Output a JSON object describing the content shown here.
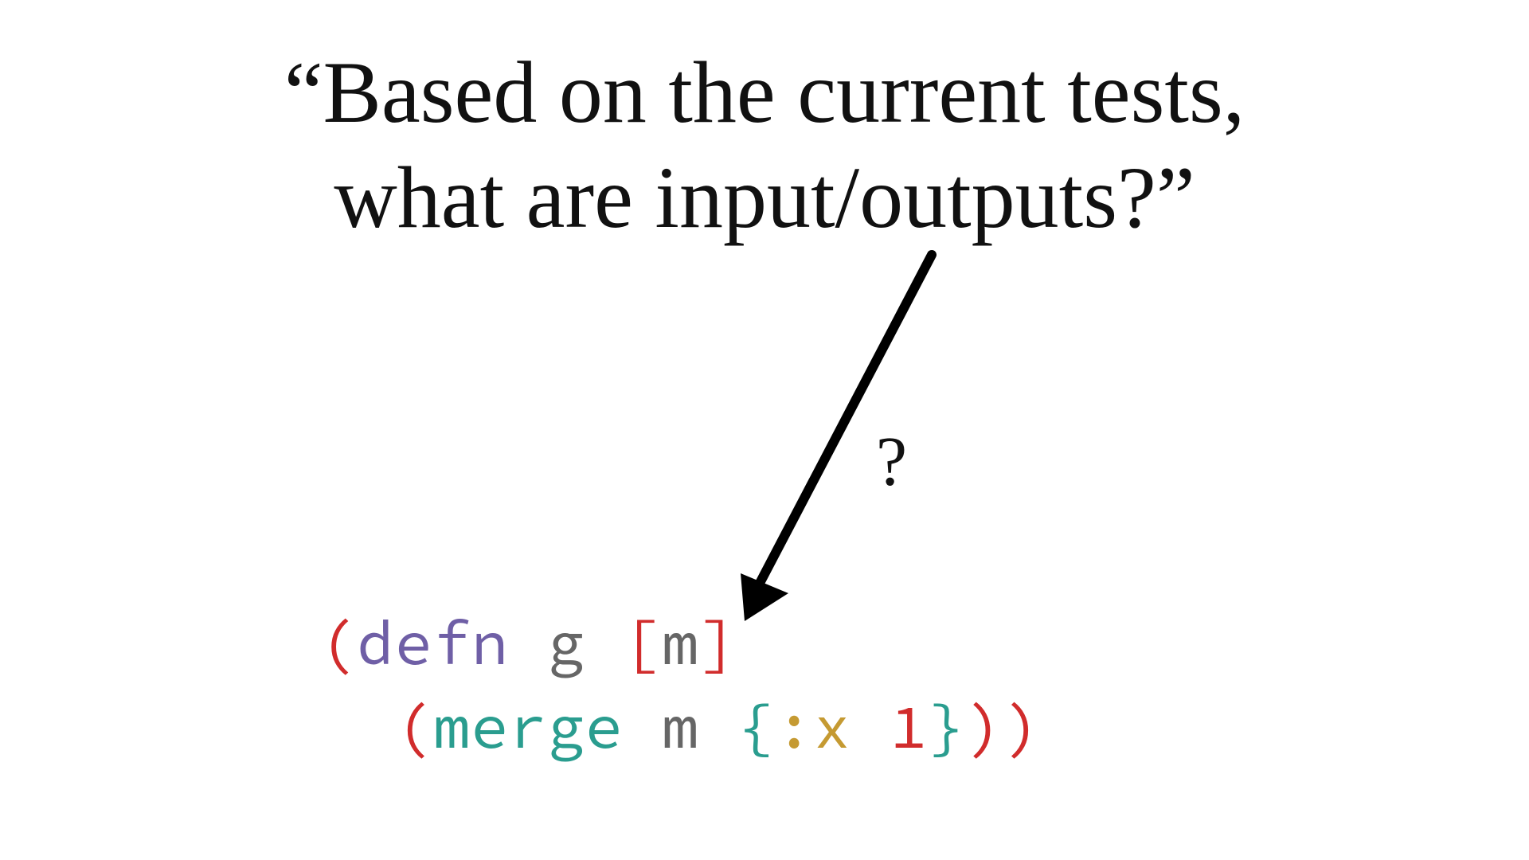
{
  "heading": {
    "line1": "“Based on the current tests,",
    "line2": "what are input/outputs?”"
  },
  "annotation": {
    "question_mark": "?"
  },
  "code": {
    "line1": {
      "paren_open": "(",
      "defn": "defn",
      "sp1": " ",
      "fn_name": "g",
      "sp2": " ",
      "bracket_open": "[",
      "param": "m",
      "bracket_close": "]"
    },
    "line2": {
      "indent": "  ",
      "paren_open": "(",
      "merge": "merge",
      "sp1": " ",
      "arg_m": "m",
      "sp2": " ",
      "brace_open": "{",
      "kw_x": ":x",
      "sp3": " ",
      "val_1": "1",
      "brace_close": "}",
      "paren_close_inner": ")",
      "paren_close_outer": ")"
    }
  }
}
